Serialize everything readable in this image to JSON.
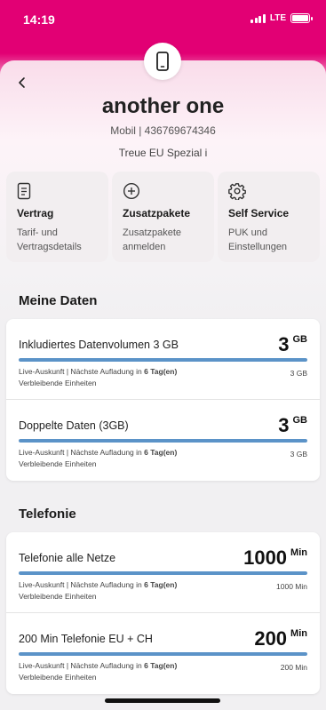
{
  "status": {
    "time": "14:19",
    "network": "LTE",
    "signal_bars": 4,
    "battery_level": 1.0
  },
  "colors": {
    "brand": "#e20074",
    "bar": "#5b93c8"
  },
  "header": {
    "device_icon": "smartphone-icon",
    "back_icon": "chevron-left-icon",
    "name": "another one",
    "line_info": "Mobil | 436769674346",
    "tariff": "Treue EU Spezial i"
  },
  "actions": [
    {
      "icon": "document-icon",
      "title": "Vertrag",
      "desc_1": "Tarif- und",
      "desc_2": "Vertragsdetails"
    },
    {
      "icon": "plus-circle-icon",
      "title": "Zusatzpakete",
      "desc_1": "Zusatzpakete",
      "desc_2": "anmelden"
    },
    {
      "icon": "gear-icon",
      "title": "Self Service",
      "desc_1": "PUK und",
      "desc_2": "Einstellungen"
    }
  ],
  "data_section": {
    "title": "Meine Daten",
    "items": [
      {
        "label": "Inkludiertes Datenvolumen 3 GB",
        "value": "3",
        "unit": "GB",
        "fill": 1.0,
        "live": "Live-Auskunft | Nächste Aufladung in ",
        "next": "6 Tag(en)",
        "remaining": "Verbleibende Einheiten",
        "total": "3 GB"
      },
      {
        "label": "Doppelte Daten (3GB)",
        "value": "3",
        "unit": "GB",
        "fill": 1.0,
        "live": "Live-Auskunft | Nächste Aufladung in ",
        "next": "6 Tag(en)",
        "remaining": "Verbleibende Einheiten",
        "total": "3 GB"
      }
    ]
  },
  "phone_section": {
    "title": "Telefonie",
    "items": [
      {
        "label": "Telefonie alle Netze",
        "value": "1000",
        "unit": "Min",
        "fill": 1.0,
        "live": "Live-Auskunft | Nächste Aufladung in ",
        "next": "6 Tag(en)",
        "remaining": "Verbleibende Einheiten",
        "total": "1000 Min"
      },
      {
        "label": "200 Min Telefonie EU + CH",
        "value": "200",
        "unit": "Min",
        "fill": 1.0,
        "live": "Live-Auskunft | Nächste Aufladung in ",
        "next": "6 Tag(en)",
        "remaining": "Verbleibende Einheiten",
        "total": "200 Min"
      }
    ]
  }
}
